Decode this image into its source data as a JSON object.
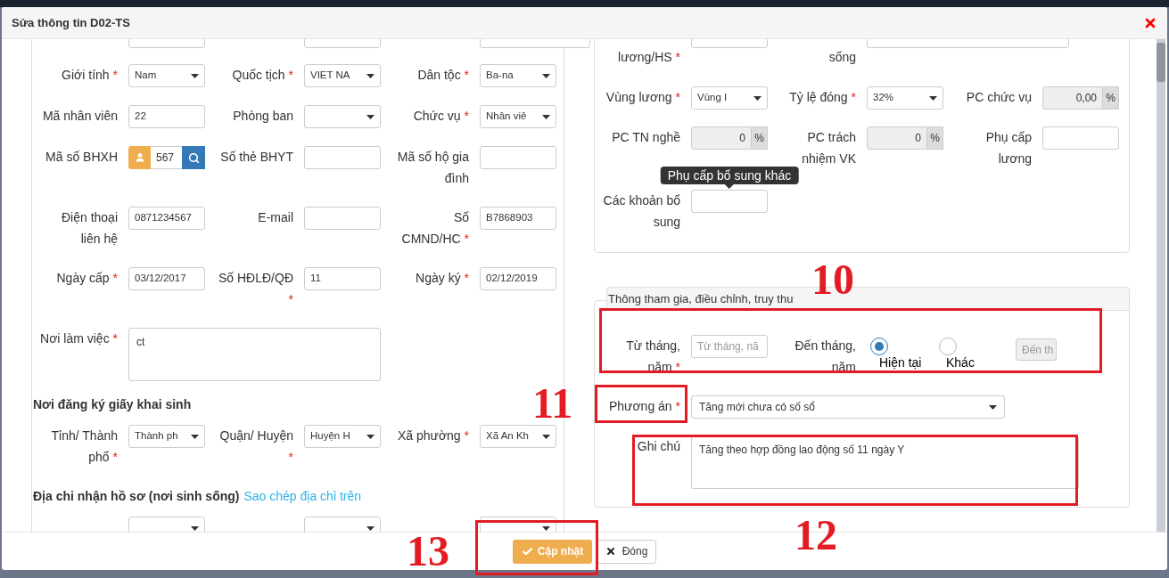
{
  "required_mark": "*",
  "dialog": {
    "title": "Sửa thông tin D02-TS"
  },
  "left": [
    {
      "kind": "clipped"
    },
    {
      "kind": "row",
      "fields": [
        {
          "label": "Giới tính",
          "required": true,
          "kind": "select",
          "value": "Nam"
        },
        {
          "label": "Quốc tịch",
          "required": true,
          "kind": "select",
          "value": "VIET NA"
        },
        {
          "label": "Dân tộc",
          "required": true,
          "kind": "select",
          "value": "Ba-na"
        }
      ]
    },
    {
      "kind": "row",
      "fields": [
        {
          "label": "Mã nhân viên",
          "required": false,
          "kind": "text",
          "value": "22"
        },
        {
          "label": "Phòng ban",
          "required": false,
          "kind": "select"
        },
        {
          "label": "Chức vụ",
          "required": true,
          "kind": "select",
          "value": "Nhân viê"
        }
      ]
    },
    {
      "kind": "row",
      "fields": [
        {
          "label": "Mã số BHXH",
          "required": false,
          "kind": "bhxh",
          "value": "567"
        },
        {
          "label": "Số thẻ BHYT",
          "required": false,
          "kind": "text"
        },
        {
          "label": "Mã số hộ gia đình",
          "required": false,
          "kind": "text"
        }
      ]
    },
    {
      "kind": "row",
      "fields": [
        {
          "label": "Điện thoại liên hệ",
          "required": false,
          "kind": "text",
          "value": "0871234567"
        },
        {
          "label": "E-mail",
          "required": false,
          "kind": "text"
        },
        {
          "label": "Số CMND/HC",
          "required": true,
          "kind": "text",
          "value": "B7868903"
        }
      ]
    },
    {
      "kind": "row",
      "fields": [
        {
          "label": "Ngày cấp",
          "required": true,
          "kind": "text",
          "value": "03/12/2017"
        },
        {
          "label": "Số HĐLĐ/QĐ",
          "required": true,
          "kind": "text",
          "value": "11"
        },
        {
          "label": "Ngày ký",
          "required": true,
          "kind": "text",
          "value": "02/12/2019"
        }
      ]
    },
    {
      "kind": "row",
      "fields": [
        {
          "label": "Nơi làm việc",
          "required": true,
          "kind": "textarea",
          "value": "ct"
        }
      ]
    },
    {
      "kind": "heading",
      "text": "Nơi đăng ký giấy khai sinh"
    },
    {
      "kind": "row",
      "fields": [
        {
          "label": "Tỉnh/ Thành phố",
          "required": true,
          "kind": "select",
          "value": "Thành ph"
        },
        {
          "label": "Quận/ Huyện",
          "required": true,
          "kind": "select",
          "value": "Huyện H"
        },
        {
          "label": "Xã phường",
          "required": true,
          "kind": "select",
          "value": "Xã An Kh"
        }
      ]
    },
    {
      "kind": "heading",
      "text": "Địa chỉ nhận hồ sơ (nơi sinh sống)",
      "link": "Sao chép địa chỉ trên"
    },
    {
      "kind": "clipped_bottom"
    }
  ],
  "salary": [
    {
      "kind": "clipped",
      "fields": [
        {
          "label": "lương/HS",
          "required": true,
          "kind": "text"
        },
        {
          "label": "sống",
          "required": false,
          "kind": "wide_text"
        }
      ]
    },
    {
      "kind": "row",
      "fields": [
        {
          "label": "Vùng lương",
          "required": true,
          "kind": "select",
          "value": "Vùng I"
        },
        {
          "label": "Tỷ lệ đóng",
          "required": true,
          "kind": "select",
          "value": "32%"
        },
        {
          "label": "PC chức vụ",
          "required": false,
          "kind": "percent",
          "value": "0,00",
          "unit": "%",
          "readonly": true
        }
      ]
    },
    {
      "kind": "row",
      "fields": [
        {
          "label": "PC TN nghề",
          "required": false,
          "kind": "percent",
          "value": "0",
          "unit": "%",
          "readonly": true
        },
        {
          "label": "PC trách nhiệm VK",
          "required": false,
          "kind": "percent",
          "value": "0",
          "unit": "%",
          "readonly": true
        },
        {
          "label": "Phụ cấp lương",
          "required": false,
          "kind": "text"
        }
      ]
    },
    {
      "kind": "row",
      "fields": [
        {
          "label": "Các khoản bổ sung",
          "required": false,
          "kind": "text",
          "tooltip": "Phụ cấp bổ sung khác"
        }
      ]
    }
  ],
  "participation": {
    "title": "Thông tham gia, điều chỉnh, truy thu",
    "from": {
      "label": "Từ tháng, năm",
      "required": true,
      "placeholder": "Từ tháng, nă"
    },
    "to": {
      "label": "Đến tháng, năm",
      "required": false,
      "placeholder": "Đến th",
      "disabled": true,
      "options": [
        {
          "label": "Hiện tại",
          "selected": true
        },
        {
          "label": "Khác",
          "selected": false
        }
      ]
    },
    "plan": {
      "label": "Phương án",
      "required": true,
      "value": "Tăng mới chưa có số sổ"
    },
    "note": {
      "label": "Ghi chú",
      "required": false,
      "value": "Tăng theo hợp đồng lao động số 11 ngày Y"
    }
  },
  "footer": [
    {
      "kind": "primary",
      "label": "Cập nhật"
    },
    {
      "kind": "default",
      "label": "Đóng"
    }
  ],
  "annotations": [
    {
      "label": "10"
    },
    {
      "label": "11"
    },
    {
      "label": "12"
    },
    {
      "label": "13"
    }
  ]
}
